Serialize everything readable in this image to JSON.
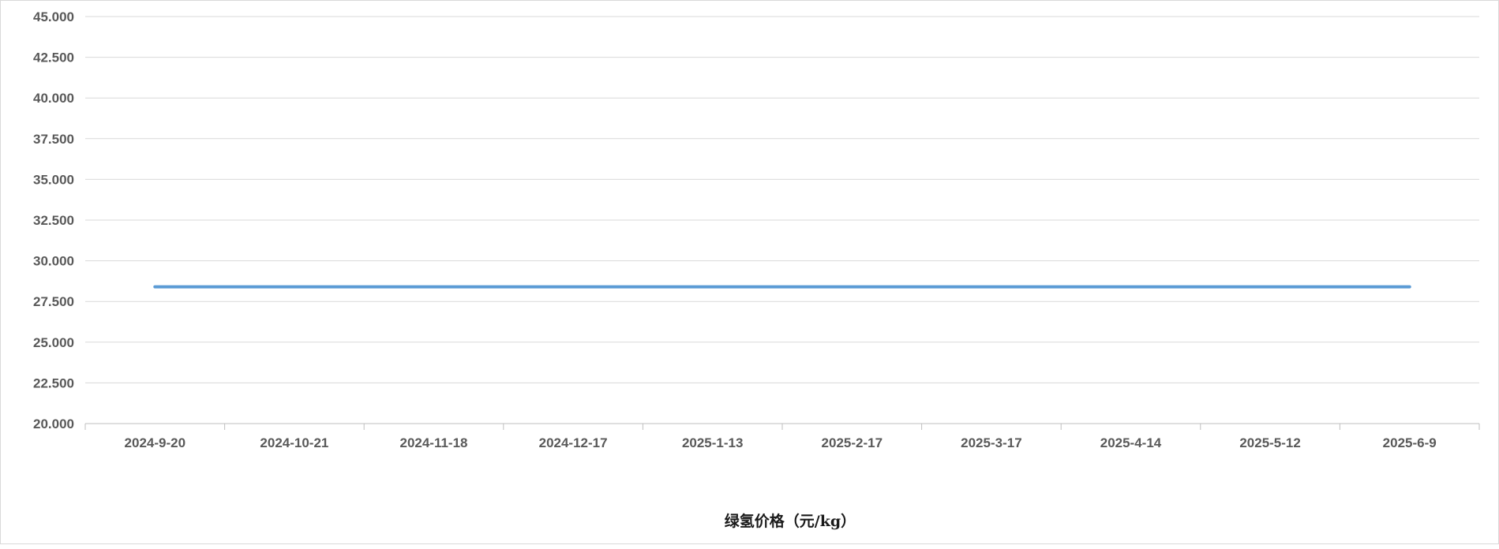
{
  "chart_data": {
    "type": "line",
    "title": "",
    "xlabel": "",
    "ylabel": "",
    "x": [
      "2024-9-20",
      "2024-10-21",
      "2024-11-18",
      "2024-12-17",
      "2025-1-13",
      "2025-2-17",
      "2025-3-17",
      "2025-4-14",
      "2025-5-12",
      "2025-6-9"
    ],
    "series": [
      {
        "name": "绿氢价格（元/kg）",
        "values": [
          28.4,
          28.4,
          28.4,
          28.4,
          28.4,
          28.4,
          28.4,
          28.4,
          28.4,
          28.4
        ]
      }
    ],
    "ylim": [
      20,
      45
    ],
    "yticks": [
      "20.000",
      "22.500",
      "25.000",
      "27.500",
      "30.000",
      "32.500",
      "35.000",
      "37.500",
      "40.000",
      "42.500",
      "45.000"
    ],
    "grid": true,
    "legend": "bottom-center",
    "colors": {
      "series": "#5b9bd5",
      "grid": "#d9d9d9",
      "axis": "#bfbfbf"
    }
  }
}
